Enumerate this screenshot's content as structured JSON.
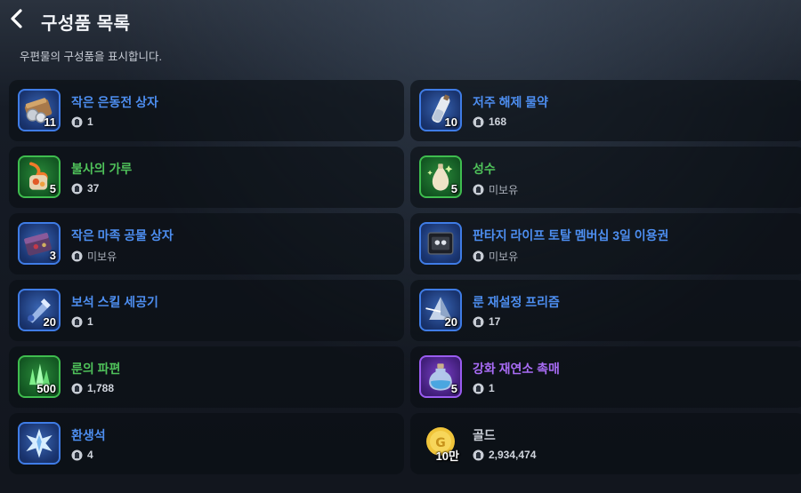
{
  "header": {
    "title": "구성품 목록",
    "subtitle": "우편물의 구성품을 표시합니다."
  },
  "colors": {
    "blue_name": "#4d8ef0",
    "green_name": "#4fc25a",
    "purple_name": "#a86cf5",
    "gray_name": "#c9ced6"
  },
  "items": [
    {
      "name": "작은 은동전 상자",
      "qty": "11",
      "owned": "1",
      "grade": "blue",
      "icon": "silver-coin-chest-icon"
    },
    {
      "name": "저주 해제 물약",
      "qty": "10",
      "owned": "168",
      "grade": "blue",
      "icon": "potion-bottle-icon"
    },
    {
      "name": "불사의 가루",
      "qty": "5",
      "owned": "37",
      "grade": "green",
      "icon": "phoenix-powder-icon"
    },
    {
      "name": "성수",
      "qty": "5",
      "owned": "미보유",
      "grade": "green",
      "icon": "holy-water-icon"
    },
    {
      "name": "작은 마족 공물 상자",
      "qty": "3",
      "owned": "미보유",
      "grade": "blue",
      "icon": "demon-tribute-box-icon"
    },
    {
      "name": "판타지 라이프 토탈 멤버십 3일 이용권",
      "qty": "",
      "owned": "미보유",
      "grade": "blue",
      "icon": "membership-ticket-icon"
    },
    {
      "name": "보석 스킬 세공기",
      "qty": "20",
      "owned": "1",
      "grade": "blue",
      "icon": "gem-crafting-tool-icon"
    },
    {
      "name": "룬 재설정 프리즘",
      "qty": "20",
      "owned": "17",
      "grade": "blue",
      "icon": "rune-prism-icon"
    },
    {
      "name": "룬의 파편",
      "qty": "500",
      "owned": "1,788",
      "grade": "green",
      "icon": "rune-shard-icon"
    },
    {
      "name": "강화 재연소 촉매",
      "qty": "5",
      "owned": "1",
      "grade": "purple",
      "icon": "catalyst-bottle-icon"
    },
    {
      "name": "환생석",
      "qty": "",
      "owned": "4",
      "grade": "blue",
      "icon": "rebirth-stone-icon"
    },
    {
      "name": "골드",
      "qty": "10만",
      "owned": "2,934,474",
      "grade": "plain",
      "icon": "gold-coin-icon"
    }
  ]
}
